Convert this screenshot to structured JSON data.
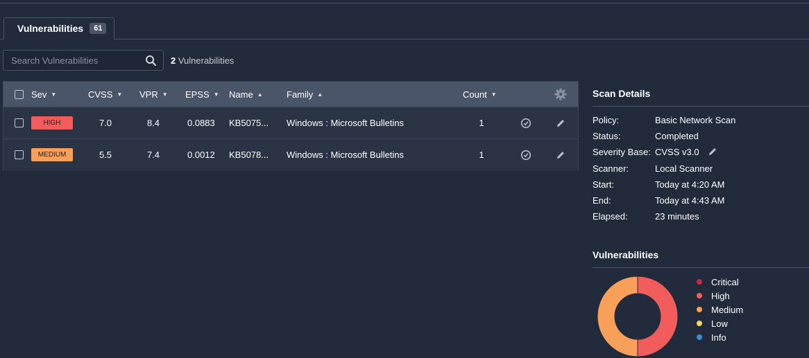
{
  "tab": {
    "label": "Vulnerabilities",
    "badge": "61"
  },
  "search": {
    "placeholder": "Search Vulnerabilities",
    "value": ""
  },
  "results": {
    "count": "2",
    "label": "Vulnerabilities"
  },
  "table": {
    "columns": {
      "sev": "Sev",
      "cvss": "CVSS",
      "vpr": "VPR",
      "epss": "EPSS",
      "name": "Name",
      "family": "Family",
      "count": "Count"
    },
    "rows": [
      {
        "sev": "HIGH",
        "sev_color": "#f25c5c",
        "cvss": "7.0",
        "vpr": "8.4",
        "epss": "0.0883",
        "name": "KB5075...",
        "family": "Windows : Microsoft Bulletins",
        "count": "1"
      },
      {
        "sev": "MEDIUM",
        "sev_color": "#f8a05a",
        "cvss": "5.5",
        "vpr": "7.4",
        "epss": "0.0012",
        "name": "KB5078...",
        "family": "Windows : Microsoft Bulletins",
        "count": "1"
      }
    ]
  },
  "scan_details": {
    "title": "Scan Details",
    "items": [
      {
        "key": "Policy:",
        "value": "Basic Network Scan"
      },
      {
        "key": "Status:",
        "value": "Completed"
      },
      {
        "key": "Severity Base:",
        "value": "CVSS v3.0"
      },
      {
        "key": "Scanner:",
        "value": "Local Scanner"
      },
      {
        "key": "Start:",
        "value": "Today at 4:20 AM"
      },
      {
        "key": "End:",
        "value": "Today at 4:43 AM"
      },
      {
        "key": "Elapsed:",
        "value": "23 minutes"
      }
    ]
  },
  "vuln_summary": {
    "title": "Vulnerabilities",
    "legend": [
      {
        "label": "Critical",
        "color": "#c8264b"
      },
      {
        "label": "High",
        "color": "#f25c5c"
      },
      {
        "label": "Medium",
        "color": "#f8a05a"
      },
      {
        "label": "Low",
        "color": "#f5d565"
      },
      {
        "label": "Info",
        "color": "#3f8fd2"
      }
    ],
    "chart_data": {
      "type": "pie",
      "categories": [
        "Critical",
        "High",
        "Medium",
        "Low",
        "Info"
      ],
      "values": [
        0,
        1,
        1,
        0,
        0
      ]
    }
  },
  "icons": {
    "search": "search-icon",
    "settings": "gear-icon",
    "accept": "check-circle-icon",
    "edit": "pencil-icon"
  }
}
